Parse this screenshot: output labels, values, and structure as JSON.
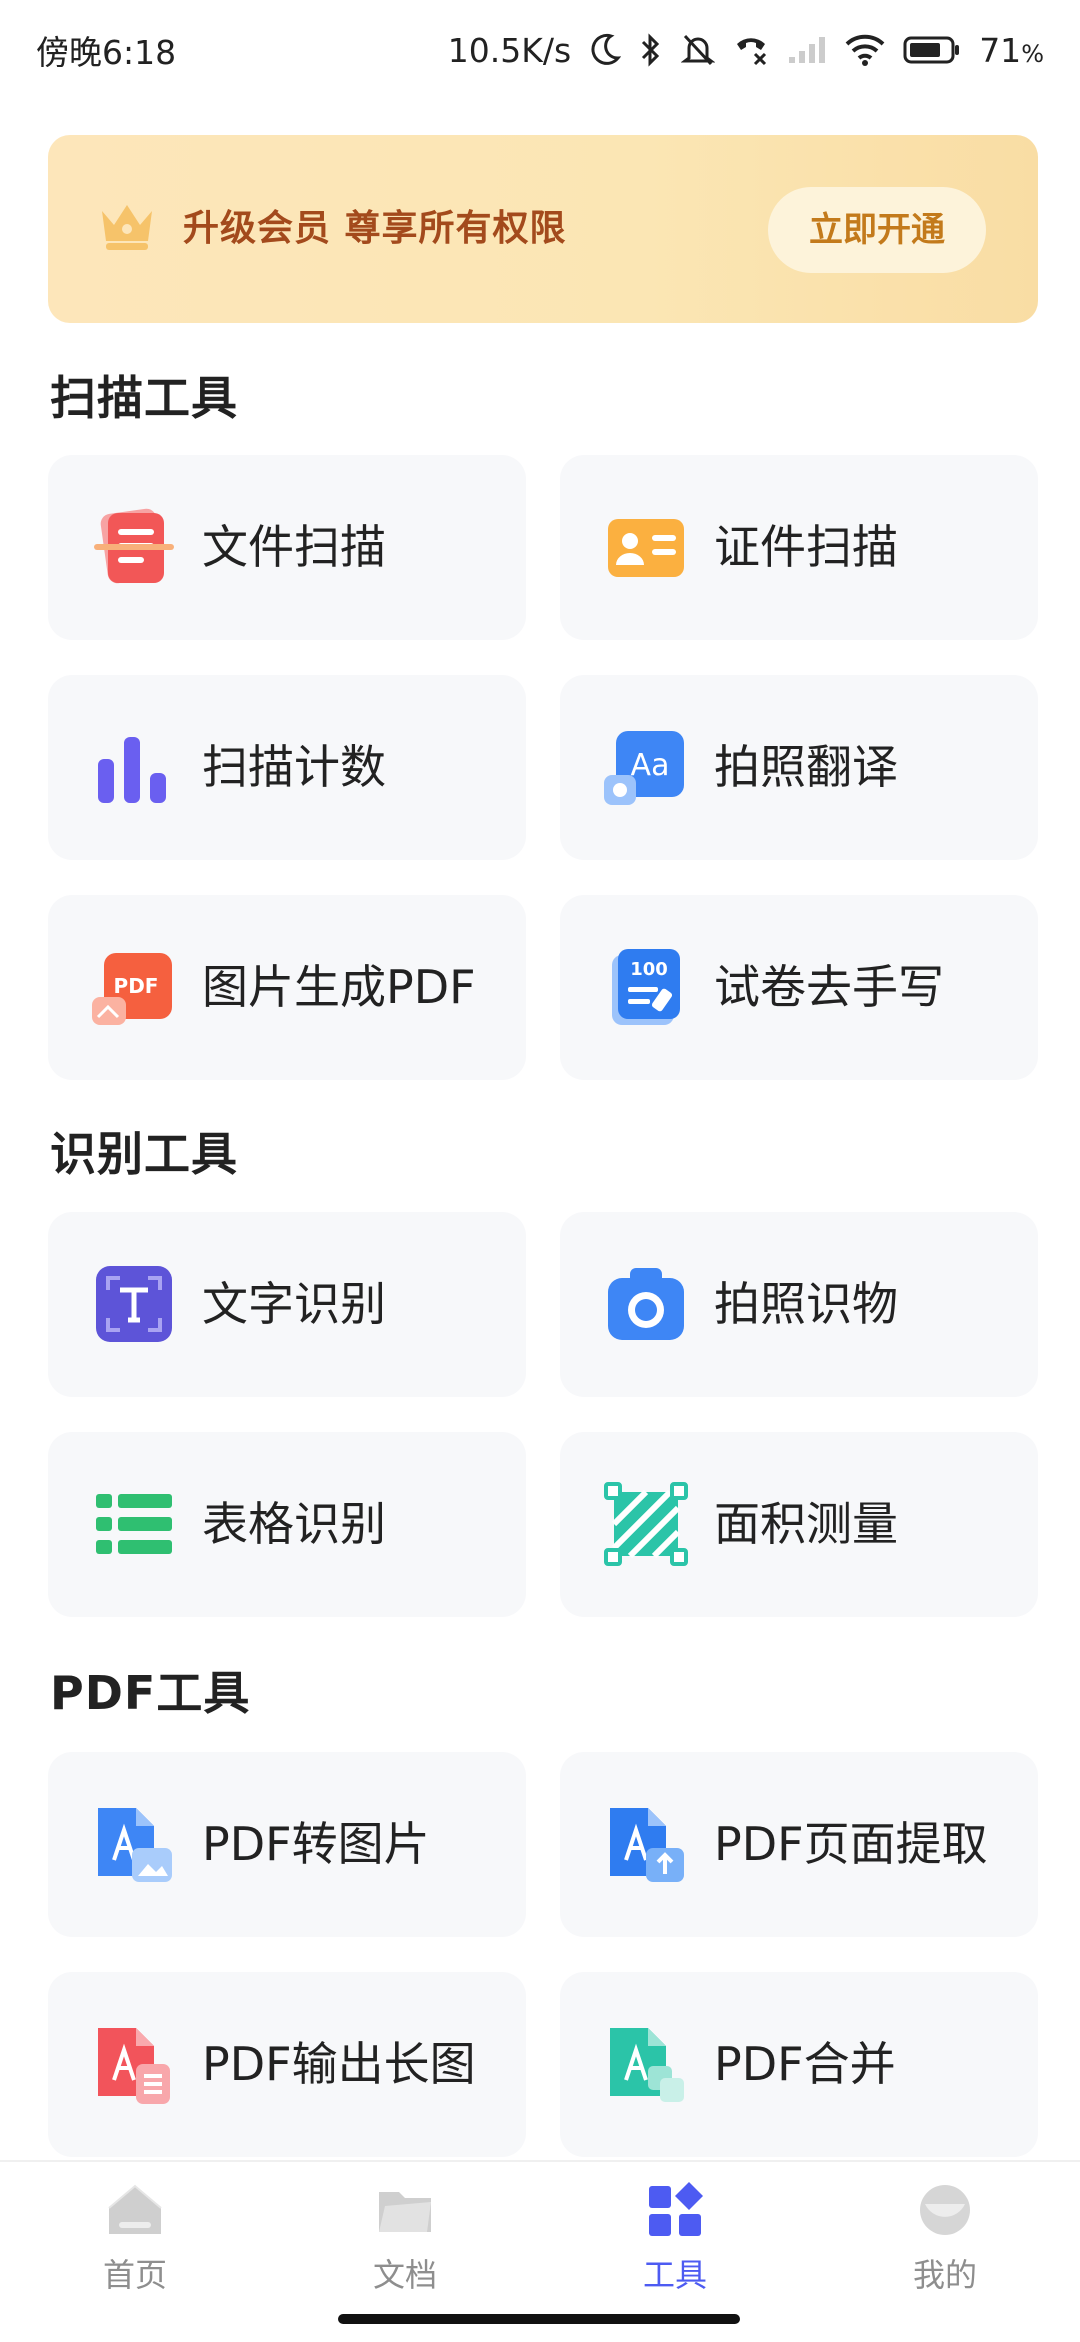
{
  "status_bar": {
    "time": "傍晚6:18",
    "net_speed": "10.5K/s",
    "battery": "71",
    "battery_unit": "%"
  },
  "banner": {
    "text": "升级会员 尊享所有权限",
    "button": "立即开通",
    "icon": "crown-icon"
  },
  "sections": [
    {
      "title": "扫描工具",
      "items": [
        {
          "label": "文件扫描",
          "icon": "document-scan-icon"
        },
        {
          "label": "证件扫描",
          "icon": "id-card-icon"
        },
        {
          "label": "扫描计数",
          "icon": "bar-count-icon"
        },
        {
          "label": "拍照翻译",
          "icon": "photo-translate-icon"
        },
        {
          "label": "图片生成PDF",
          "icon": "image-to-pdf-icon"
        },
        {
          "label": "试卷去手写",
          "icon": "exam-paper-icon"
        }
      ]
    },
    {
      "title": "识别工具",
      "items": [
        {
          "label": "文字识别",
          "icon": "text-recognition-icon"
        },
        {
          "label": "拍照识物",
          "icon": "camera-icon"
        },
        {
          "label": "表格识别",
          "icon": "table-recognition-icon"
        },
        {
          "label": "面积测量",
          "icon": "area-measure-icon"
        }
      ]
    },
    {
      "title": "PDF工具",
      "items": [
        {
          "label": "PDF转图片",
          "icon": "pdf-to-image-icon"
        },
        {
          "label": "PDF页面提取",
          "icon": "pdf-extract-icon"
        },
        {
          "label": "PDF输出长图",
          "icon": "pdf-long-image-icon"
        },
        {
          "label": "PDF合并",
          "icon": "pdf-merge-icon"
        }
      ]
    }
  ],
  "bottom_nav": [
    {
      "label": "首页",
      "icon": "home-icon",
      "active": false
    },
    {
      "label": "文档",
      "icon": "folder-icon",
      "active": false
    },
    {
      "label": "工具",
      "icon": "tools-icon",
      "active": true
    },
    {
      "label": "我的",
      "icon": "profile-icon",
      "active": false
    }
  ],
  "colors": {
    "accent": "#4d5bf2",
    "banner_text": "#a34a1c",
    "banner_button_text": "#c37a1b",
    "card_bg": "#f7f8fa"
  }
}
